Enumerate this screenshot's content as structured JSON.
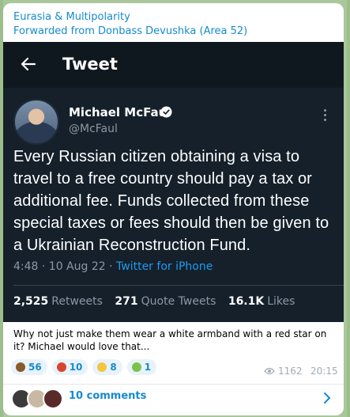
{
  "message": {
    "channel_name": "Eurasia & Multipolarity",
    "forwarded_from": "Forwarded from Donbass Devushka (Area 52)",
    "caption": "Why not just make them wear a white armband with a red star on it? Michael would love that...",
    "views": "1162",
    "time": "20:15",
    "comments_label": "10 comments"
  },
  "tweet": {
    "header_title": "Tweet",
    "author_name": "Michael McFaul",
    "author_handle": "@McFaul",
    "text": "Every Russian citizen obtaining a visa to travel to a free country should pay a tax or additional fee. Funds collected from these special taxes or fees should then be given to  a Ukrainian Reconstruction Fund.",
    "timestamp": "4:48 · 10 Aug 22 ·",
    "source": "Twitter for iPhone",
    "retweets_count": "2,525",
    "retweets_label": "Retweets",
    "quotes_count": "271",
    "quotes_label": "Quote Tweets",
    "likes_count": "16.1K",
    "likes_label": "Likes"
  },
  "reactions": [
    {
      "icon": "poop-emoji",
      "count": "56",
      "color": "#8b5a2b"
    },
    {
      "icon": "angry-face-emoji",
      "count": "10",
      "color": "#d9442e"
    },
    {
      "icon": "grinning-face-emoji",
      "count": "8",
      "color": "#f4c542"
    },
    {
      "icon": "nauseated-face-emoji",
      "count": "1",
      "color": "#7cc24a"
    }
  ],
  "colors": {
    "link": "#168acd",
    "tweet_bg": "#15202b",
    "twitter_blue": "#1d9bf0",
    "chat_bg": "#a9c79a"
  }
}
